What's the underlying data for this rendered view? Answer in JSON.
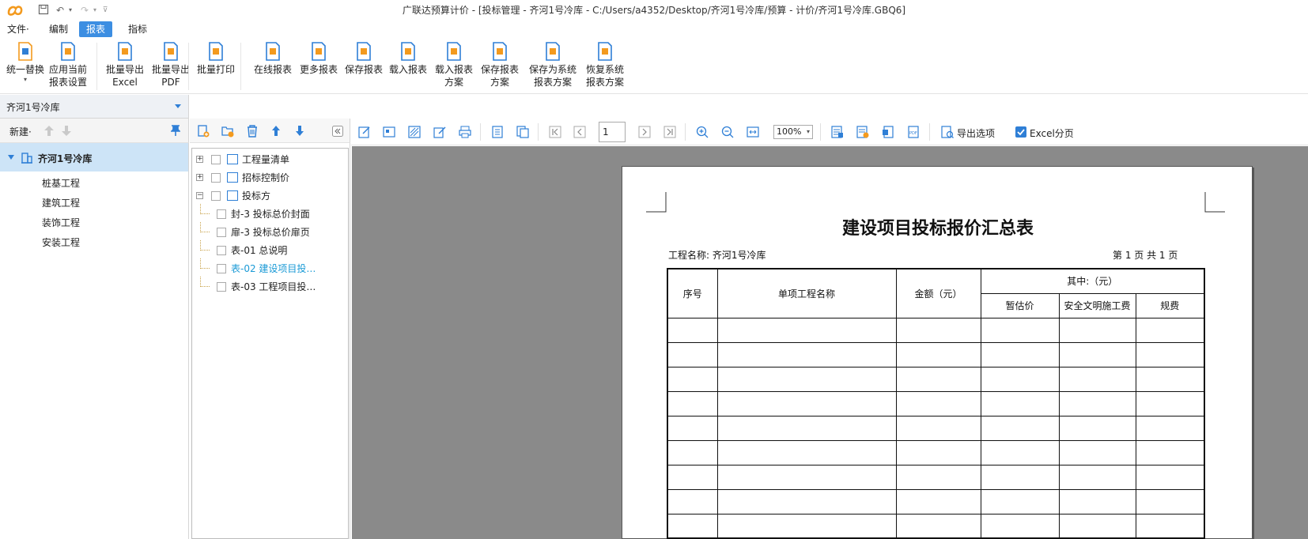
{
  "window": {
    "title": "广联达预算计价 - [投标管理 - 齐河1号冷库 - C:/Users/a4352/Desktop/齐河1号冷库/预算 - 计价/齐河1号冷库.GBQ6]"
  },
  "menu": {
    "items": [
      {
        "label": "文件·"
      },
      {
        "label": "编制"
      },
      {
        "label": "报表"
      },
      {
        "label": "指标"
      }
    ]
  },
  "ribbon": {
    "buttons": [
      {
        "label": "统一替换",
        "icon": "replace-icon"
      },
      {
        "label": "应用当前\n报表设置",
        "icon": "apply-settings-icon"
      },
      {
        "label": "批量导出\nExcel",
        "icon": "export-excel-icon"
      },
      {
        "label": "批量导出\nPDF",
        "icon": "export-pdf-icon"
      },
      {
        "label": "批量打印",
        "icon": "print-icon"
      },
      {
        "label": "在线报表",
        "icon": "online-report-icon"
      },
      {
        "label": "更多报表",
        "icon": "more-reports-icon"
      },
      {
        "label": "保存报表",
        "icon": "save-report-icon"
      },
      {
        "label": "载入报表",
        "icon": "load-report-icon"
      },
      {
        "label": "载入报表\n方案",
        "icon": "load-scheme-icon"
      },
      {
        "label": "保存报表\n方案",
        "icon": "save-scheme-icon"
      },
      {
        "label": "保存为系统\n报表方案",
        "icon": "save-system-scheme-icon"
      },
      {
        "label": "恢复系统\n报表方案",
        "icon": "restore-scheme-icon"
      }
    ]
  },
  "left_panel": {
    "project_name": "齐河1号冷库",
    "new_label": "新建·",
    "tree_root": "齐河1号冷库",
    "children": [
      "桩基工程",
      "建筑工程",
      "装饰工程",
      "安装工程"
    ]
  },
  "report_tree": {
    "nodes": [
      {
        "label": "工程量清单",
        "expander": "+",
        "level": 0
      },
      {
        "label": "招标控制价",
        "expander": "+",
        "level": 0
      },
      {
        "label": "投标方",
        "expander": "−",
        "level": 0
      },
      {
        "label": "封-3  投标总价封面",
        "level": 1
      },
      {
        "label": "扉-3  投标总价扉页",
        "level": 1
      },
      {
        "label": "表-01  总说明",
        "level": 1
      },
      {
        "label": "表-02  建设项目投…",
        "level": 1,
        "selected": true
      },
      {
        "label": "表-03  工程项目投…",
        "level": 1
      }
    ]
  },
  "preview_toolbar": {
    "page_value": "1",
    "zoom_value": "100%",
    "export_options_label": "导出选项",
    "excel_paging_label": "Excel分页",
    "excel_paging_checked": true
  },
  "document": {
    "title": "建设项目投标报价汇总表",
    "project_label": "工程名称: 齐河1号冷库",
    "page_info": "第  1  页 共  1  页",
    "headers": {
      "seq": "序号",
      "name": "单项工程名称",
      "amount": "金额（元）",
      "of_which": "其中:（元）",
      "provisional": "暂估价",
      "safety": "安全文明施工费",
      "fees": "规费"
    },
    "empty_rows": 9
  },
  "colors": {
    "accent": "#3c8ee2",
    "selected_row": "#cde4f7",
    "selected_text": "#1a9ad6",
    "preview_bg": "#8a8a8a"
  }
}
